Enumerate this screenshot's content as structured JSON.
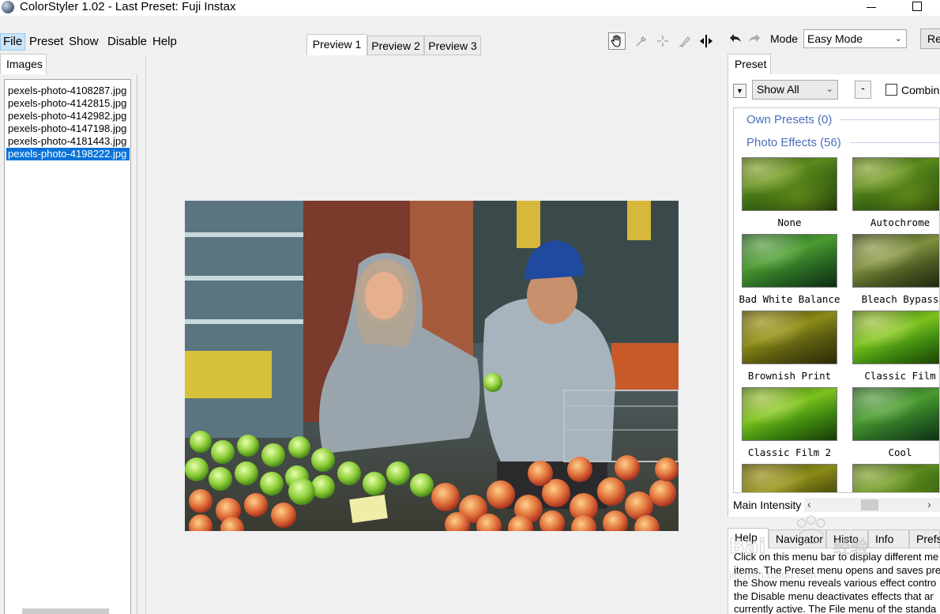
{
  "window": {
    "title": "ColorStyler 1.02 - Last Preset: Fuji Instax"
  },
  "menu": {
    "items": [
      "File",
      "Preset",
      "Show",
      "Disable",
      "Help"
    ]
  },
  "images_panel": {
    "tab_label": "Images",
    "files": [
      "pexels-photo-4108287.jpg",
      "pexels-photo-4142815.jpg",
      "pexels-photo-4142982.jpg",
      "pexels-photo-4147198.jpg",
      "pexels-photo-4181443.jpg",
      "pexels-photo-4198222.jpg"
    ],
    "selected_index": 5
  },
  "preview": {
    "tabs": [
      "Preview 1",
      "Preview 2",
      "Preview 3"
    ],
    "active_tab": 0
  },
  "toolbar": {
    "tools": [
      "hand-icon",
      "eyedropper-icon",
      "crosshair-icon",
      "brush-icon",
      "split-view-icon"
    ],
    "mode_label": "Mode",
    "mode_value": "Easy Mode",
    "reset_label": "Re"
  },
  "preset_panel": {
    "tab_label": "Preset",
    "filter_value": "Show All",
    "dot_button": "-",
    "combine_label": "Combine",
    "groups": [
      {
        "name": "Own Presets (0)"
      },
      {
        "name": "Photo Effects (56)"
      }
    ],
    "presets": [
      "None",
      "Autochrome",
      "Bad White Balance",
      "Bleach Bypass",
      "Brownish Print",
      "Classic Film",
      "Classic Film 2",
      "Cool"
    ],
    "intensity_label": "Main Intensity"
  },
  "help_panel": {
    "tabs": [
      "Help",
      "Navigator",
      "Histo",
      "Info",
      "Prefs"
    ],
    "active_tab": 0,
    "text_lines": [
      "Click on this menu bar to display different me",
      "items. The Preset menu opens and saves pre",
      "the Show menu reveals various effect contro",
      "the Disable menu deactivates effects that ar",
      "currently active. The File menu of the standa"
    ]
  },
  "watermark": {
    "text": "Bai du 经验",
    "url": "jingyan.baidu.com"
  }
}
